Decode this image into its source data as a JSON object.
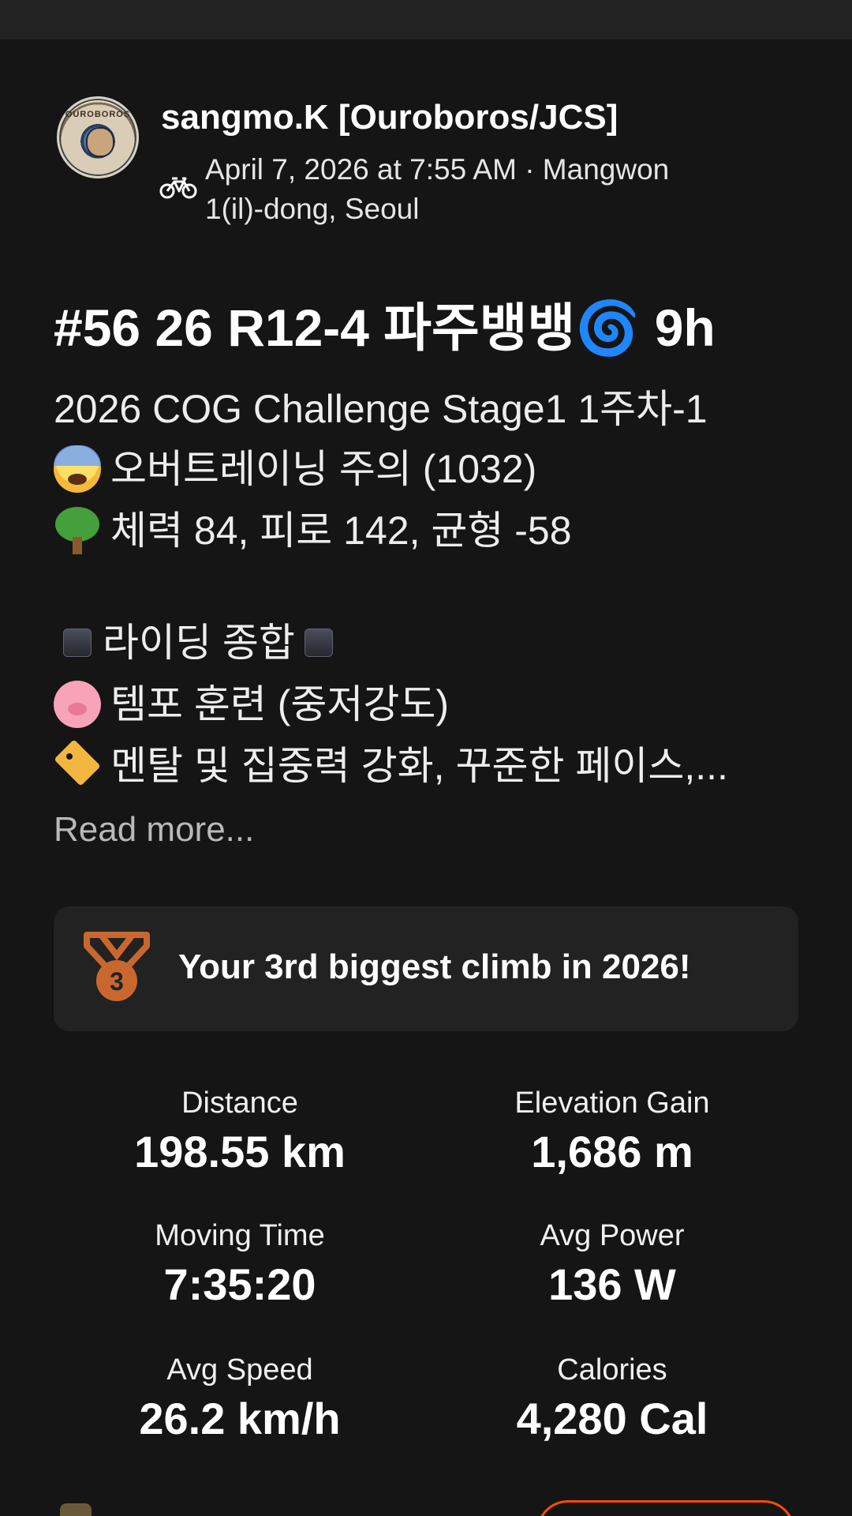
{
  "post": {
    "author_name": "sangmo.K [Ouroboros/JCS]",
    "avatar_text": "OUROBOROS",
    "meta": "April 7, 2026 at 7:55 AM · Mangwon 1(il)-dong, Seoul",
    "activity_icon": "bike-icon"
  },
  "activity": {
    "title": "#56 26 R12-4 파주뱅뱅🌀 9h",
    "description_lines": [
      "2026 COG Challenge Stage1 1주차-1",
      "오버트레이닝 주의 (1032)",
      "체력 84, 피로 142, 균형 -58",
      "라이딩 종합",
      "템포 훈련 (중저강도)",
      "멘탈 및 집중력 강화, 꾸준한 페이스,..."
    ],
    "read_more": "Read more..."
  },
  "achievement": {
    "text": "Your 3rd biggest climb in 2026!",
    "medal_number": "3",
    "medal_color": "#c8682f"
  },
  "stats": [
    {
      "label": "Distance",
      "value": "198.55 km"
    },
    {
      "label": "Elevation Gain",
      "value": "1,686 m"
    },
    {
      "label": "Moving Time",
      "value": "7:35:20"
    },
    {
      "label": "Avg Power",
      "value": "136 W"
    },
    {
      "label": "Avg Speed",
      "value": "26.2 km/h"
    },
    {
      "label": "Calories",
      "value": "4,280 Cal"
    }
  ],
  "colors": {
    "background": "#151515",
    "card": "#222222",
    "accent": "#fc4c02"
  }
}
